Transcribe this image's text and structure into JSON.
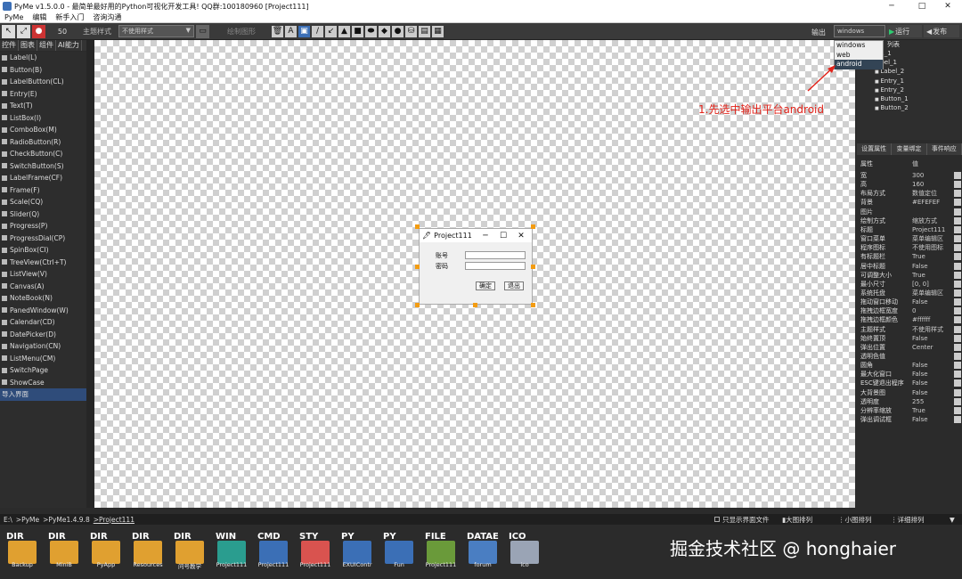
{
  "window": {
    "title": "PyMe v1.5.0.0 - 最简单最好用的Python可视化开发工具! QQ群:100180960    [Project111]",
    "minimize": "─",
    "maximize": "□",
    "close": "✕"
  },
  "menu": [
    "PyMe",
    "编辑",
    "新手入门",
    "咨询沟通"
  ],
  "toolbar": {
    "zoom": "50",
    "theme_label": "主题样式",
    "theme_value": "不使用样式",
    "draw_label": "绘制图形",
    "output_label": "输出",
    "platform_value": "windows",
    "run_label": "运行",
    "publish_label": "发布"
  },
  "platform_options": [
    "windows",
    "web",
    "android"
  ],
  "left_tabs": [
    "控件",
    "图表",
    "组件",
    "AI能力"
  ],
  "widgets": [
    "Label(L)",
    "Button(B)",
    "LabelButton(CL)",
    "Entry(E)",
    "Text(T)",
    "ListBox(I)",
    "ComboBox(M)",
    "RadioButton(R)",
    "CheckButton(C)",
    "SwitchButton(S)",
    "LabelFrame(CF)",
    "Frame(F)",
    "Scale(CQ)",
    "Slider(Q)",
    "Progress(P)",
    "ProgressDial(CP)",
    "SpinBox(CI)",
    "TreeView(Ctrl+T)",
    "ListView(V)",
    "Canvas(A)",
    "NoteBook(N)",
    "PanedWindow(W)",
    "Calendar(CD)",
    "DatePicker(D)",
    "Navigation(CN)",
    "ListMenu(CM)",
    "SwitchPage",
    "ShowCase",
    "导入界面"
  ],
  "form": {
    "title": "Project111",
    "account_label": "账号",
    "password_label": "密码",
    "ok_label": "确定",
    "exit_label": "退出"
  },
  "tree": {
    "header": "列表",
    "items": [
      "1_1",
      "bel_1",
      "Label_2",
      "Entry_1",
      "Entry_2",
      "Button_1",
      "Button_2"
    ]
  },
  "annotation": "1.先选中输出平台android",
  "prop_tabs": [
    "设置属性",
    "变量绑定",
    "事件响应"
  ],
  "props": {
    "header_key": "属性",
    "header_val": "值",
    "rows": [
      [
        "宽",
        "300"
      ],
      [
        "高",
        "160"
      ],
      [
        "布局方式",
        "数值定位"
      ],
      [
        "背景",
        "#EFEFEF"
      ],
      [
        "图片",
        ""
      ],
      [
        "绘制方式",
        "缩放方式"
      ],
      [
        "标题",
        "Project111"
      ],
      [
        "窗口菜单",
        "菜单编辑区"
      ],
      [
        "程序图标",
        "不使用图标"
      ],
      [
        "有标题栏",
        "True"
      ],
      [
        "居中标题",
        "False"
      ],
      [
        "可调整大小",
        "True"
      ],
      [
        "最小尺寸",
        "[0, 0]"
      ],
      [
        "系统托盘",
        "菜单编辑区"
      ],
      [
        "拖动窗口移动",
        "False"
      ],
      [
        "拖拽边框宽度",
        "0"
      ],
      [
        "拖拽边框颜色",
        "#ffffff"
      ],
      [
        "主题样式",
        "不使用样式"
      ],
      [
        "始终置顶",
        "False"
      ],
      [
        "弹出位置",
        "Center"
      ],
      [
        "透明色值",
        ""
      ],
      [
        "圆角",
        "False"
      ],
      [
        "最大化窗口",
        "False"
      ],
      [
        "ESC键退出程序",
        "False"
      ],
      [
        "大背景图",
        "False"
      ],
      [
        "透明度",
        "255"
      ],
      [
        "分辨率缩放",
        "True"
      ],
      [
        "弹出调试框",
        "False"
      ]
    ]
  },
  "status": {
    "path_parts": [
      "E:\\",
      ">PyMe",
      ">PyMe1.4.9.8",
      ">Project111"
    ],
    "only_ui": "只显示界面文件",
    "big": "大图排列",
    "small": "小图排列",
    "detail": "详细排列"
  },
  "files": [
    {
      "tag": "DIR",
      "name": "Backup",
      "color": "#e0a030"
    },
    {
      "tag": "DIR",
      "name": "MiniB",
      "color": "#e0a030"
    },
    {
      "tag": "DIR",
      "name": "PyApp",
      "color": "#e0a030"
    },
    {
      "tag": "DIR",
      "name": "Resources",
      "color": "#e0a030"
    },
    {
      "tag": "DIR",
      "name": "问号教学",
      "color": "#e0a030"
    },
    {
      "tag": "WIN",
      "name": "Project111",
      "color": "#2a9d8f"
    },
    {
      "tag": "CMD",
      "name": "Project111",
      "color": "#3b6fb6"
    },
    {
      "tag": "STY",
      "name": "Project111",
      "color": "#d9534f"
    },
    {
      "tag": "PY",
      "name": "EXUIContr",
      "color": "#3b6fb6"
    },
    {
      "tag": "PY",
      "name": "Fun",
      "color": "#3b6fb6"
    },
    {
      "tag": "FILE",
      "name": "Project111",
      "color": "#6a9a3a"
    },
    {
      "tag": "DATAE",
      "name": "forum",
      "color": "#4a7ec2"
    },
    {
      "tag": "ICO",
      "name": "ico",
      "color": "#9aa4b5"
    }
  ],
  "watermark": "掘金技术社区 @ honghaier"
}
